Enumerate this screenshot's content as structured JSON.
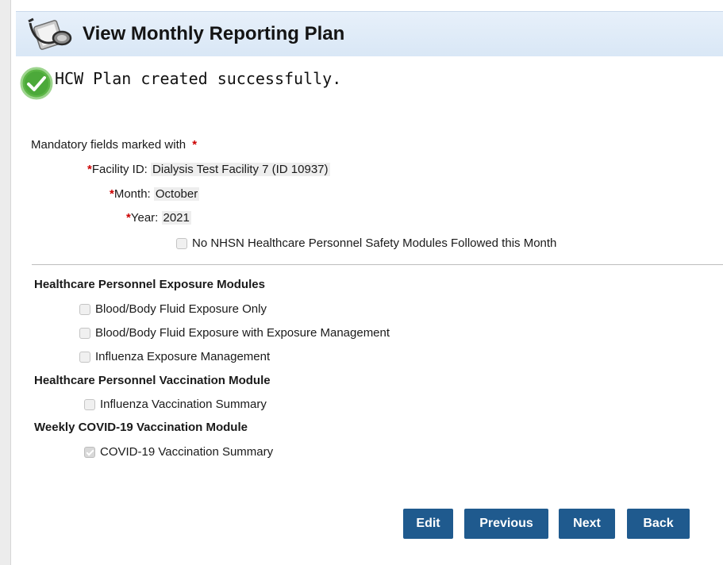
{
  "header": {
    "title": "View Monthly Reporting Plan"
  },
  "message": {
    "success": "HCW Plan created successfully."
  },
  "form": {
    "mandatory_note": "Mandatory fields marked with",
    "required_marker": "*",
    "facility_label": "Facility ID:",
    "facility_value": "Dialysis Test Facility 7 (ID 10937)",
    "month_label": "Month:",
    "month_value": "October",
    "year_label": "Year:",
    "year_value": "2021",
    "no_modules_label": "No NHSN Healthcare Personnel Safety Modules Followed this Month",
    "no_modules_checked": false
  },
  "sections": {
    "exposure": {
      "title": "Healthcare Personnel Exposure Modules",
      "items": [
        {
          "label": "Blood/Body Fluid Exposure Only",
          "checked": false
        },
        {
          "label": "Blood/Body Fluid Exposure with Exposure Management",
          "checked": false
        },
        {
          "label": "Influenza Exposure Management",
          "checked": false
        }
      ]
    },
    "vaccination": {
      "title": "Healthcare Personnel Vaccination Module",
      "items": [
        {
          "label": "Influenza Vaccination Summary",
          "checked": false
        }
      ]
    },
    "covid": {
      "title": "Weekly COVID-19 Vaccination Module",
      "items": [
        {
          "label": "COVID-19 Vaccination Summary",
          "checked": true
        }
      ]
    }
  },
  "buttons": {
    "edit": "Edit",
    "previous": "Previous",
    "next": "Next",
    "back": "Back"
  },
  "colors": {
    "header_bg": "#dde9f6",
    "required": "#cc0000",
    "button_bg": "#1f5a8e",
    "success": "#4caf3a"
  },
  "icons": {
    "header": "stethoscope-clipboard-icon",
    "success": "check-circle-icon"
  }
}
